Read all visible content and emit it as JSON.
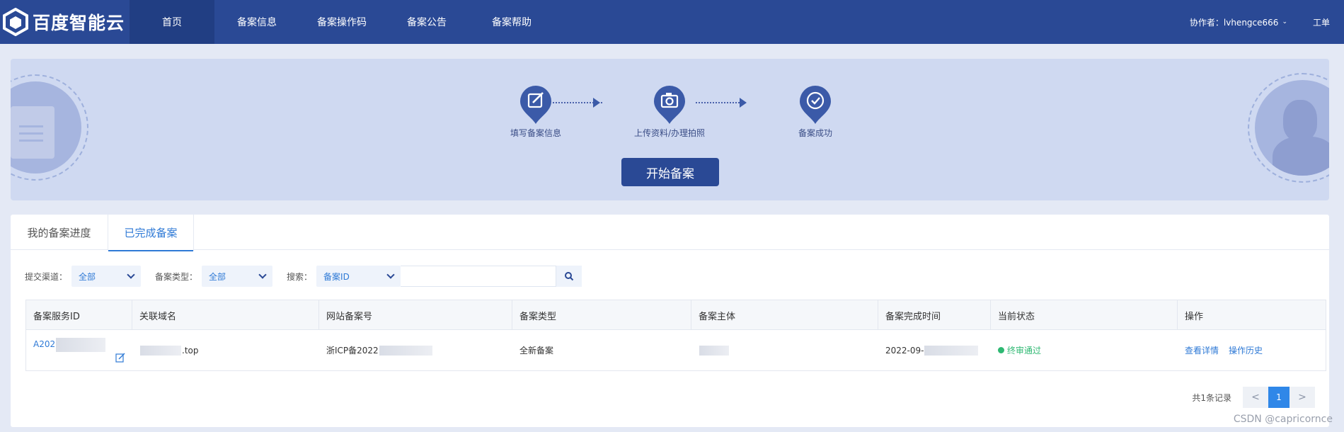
{
  "header": {
    "logo_text": "百度智能云",
    "nav": [
      {
        "label": "首页",
        "active": true
      },
      {
        "label": "备案信息",
        "active": false
      },
      {
        "label": "备案操作码",
        "active": false
      },
      {
        "label": "备案公告",
        "active": false
      },
      {
        "label": "备案帮助",
        "active": false
      }
    ],
    "collaborator": "协作者：lvhengce666",
    "workorder": "工单"
  },
  "banner": {
    "steps": [
      {
        "label": "填写备案信息",
        "icon": "edit-icon"
      },
      {
        "label": "上传资料/办理拍照",
        "icon": "camera-icon"
      },
      {
        "label": "备案成功",
        "icon": "check-icon"
      }
    ],
    "start_button": "开始备案"
  },
  "tabs": [
    {
      "label": "我的备案进度",
      "active": false
    },
    {
      "label": "已完成备案",
      "active": true
    }
  ],
  "filters": {
    "channel_label": "提交渠道：",
    "channel_value": "全部",
    "type_label": "备案类型：",
    "type_value": "全部",
    "search_label": "搜索：",
    "search_field": "备案ID",
    "search_value": ""
  },
  "table": {
    "columns": [
      "备案服务ID",
      "关联域名",
      "网站备案号",
      "备案类型",
      "备案主体",
      "备案完成时间",
      "当前状态",
      "操作"
    ],
    "rows": [
      {
        "id": "A202",
        "domain": ".top",
        "icp": "浙ICP备2022",
        "type": "全新备案",
        "subject": "",
        "completed": "2022-09-",
        "status": "终审通过",
        "actions": [
          "查看详情",
          "操作历史"
        ]
      }
    ]
  },
  "pagination": {
    "total": "共1条记录",
    "prev": "<",
    "current": "1",
    "next": ">"
  },
  "watermark": "CSDN @capricornce",
  "colors": {
    "nav_bg": "#2a4995",
    "accent": "#2f7ad6",
    "status_ok": "#2eb872"
  }
}
